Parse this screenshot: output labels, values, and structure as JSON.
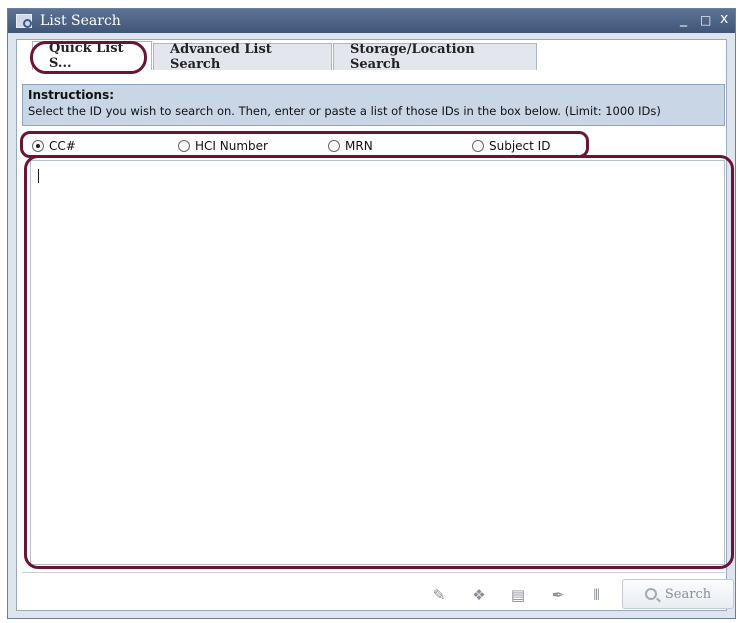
{
  "window": {
    "title": "List Search",
    "controls": {
      "minimize": "_",
      "maximize": "□",
      "close": "x"
    }
  },
  "tabs": [
    {
      "label": "Quick List S...",
      "active": true
    },
    {
      "label": "Advanced List Search",
      "active": false
    },
    {
      "label": "Storage/Location Search",
      "active": false
    }
  ],
  "instructions": {
    "heading": "Instructions:",
    "text": "Select the ID you wish to search on. Then, enter or paste a list of those IDs in the box below. (Limit: 1000 IDs)"
  },
  "id_types": [
    {
      "label": "CC#",
      "selected": true
    },
    {
      "label": "HCI Number",
      "selected": false
    },
    {
      "label": "MRN",
      "selected": false
    },
    {
      "label": "Subject ID",
      "selected": false
    }
  ],
  "ids_input": {
    "value": ""
  },
  "toolbar": {
    "icons": [
      "pen-icon",
      "badge-icon",
      "copy-icon",
      "feather-pen-icon",
      "barcode-icon"
    ],
    "search_label": "Search"
  },
  "colors": {
    "titlebar": "#4a6285",
    "highlight": "#6a1533",
    "instructions_bg": "#c9d6e6"
  }
}
